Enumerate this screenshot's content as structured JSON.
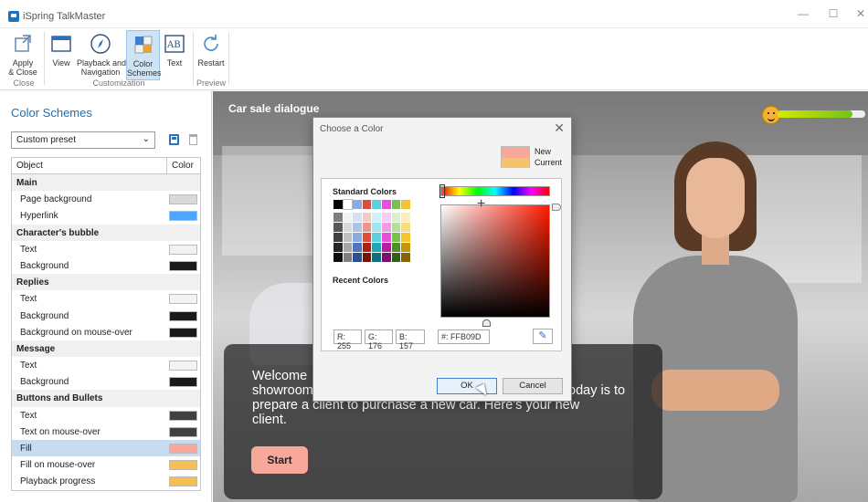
{
  "window": {
    "title": "iSpring TalkMaster",
    "minimize": "—",
    "maximize": "☐",
    "close": "✕"
  },
  "ribbon": {
    "buttons": [
      {
        "label": "Apply\n& Close",
        "icon": "apply-close-icon"
      },
      {
        "label": "View",
        "icon": "view-icon"
      },
      {
        "label": "Playback and\nNavigation",
        "icon": "compass-icon"
      },
      {
        "label": "Color\nSchemes",
        "icon": "color-schemes-icon"
      },
      {
        "label": "Text",
        "icon": "text-icon"
      },
      {
        "label": "Restart",
        "icon": "restart-icon"
      }
    ],
    "groups": [
      "Close",
      "Customization",
      "Preview"
    ]
  },
  "left_panel": {
    "title": "Color Schemes",
    "preset": "Custom preset",
    "table": {
      "col_object": "Object",
      "col_color": "Color",
      "rows": [
        {
          "type": "group",
          "label": "Main"
        },
        {
          "type": "item",
          "label": "Page background",
          "color": "#d9d9d9"
        },
        {
          "type": "item",
          "label": "Hyperlink",
          "color": "#4da6ff"
        },
        {
          "type": "group",
          "label": "Character's bubble"
        },
        {
          "type": "item",
          "label": "Text",
          "color": "#f2f2f2"
        },
        {
          "type": "item",
          "label": "Background",
          "color": "#1a1a1a"
        },
        {
          "type": "group",
          "label": "Replies"
        },
        {
          "type": "item",
          "label": "Text",
          "color": "#f2f2f2"
        },
        {
          "type": "item",
          "label": "Background",
          "color": "#1a1a1a"
        },
        {
          "type": "item",
          "label": "Background on mouse-over",
          "color": "#1a1a1a"
        },
        {
          "type": "group",
          "label": "Message"
        },
        {
          "type": "item",
          "label": "Text",
          "color": "#f2f2f2"
        },
        {
          "type": "item",
          "label": "Background",
          "color": "#1a1a1a"
        },
        {
          "type": "group",
          "label": "Buttons and Bullets"
        },
        {
          "type": "item",
          "label": "Text",
          "color": "#404040"
        },
        {
          "type": "item",
          "label": "Text on mouse-over",
          "color": "#404040"
        },
        {
          "type": "item",
          "label": "Fill",
          "color": "#f8a89b",
          "selected": true
        },
        {
          "type": "item",
          "label": "Fill on mouse-over",
          "color": "#f5bf54"
        },
        {
          "type": "item",
          "label": "Playback progress",
          "color": "#f5bf54"
        }
      ]
    }
  },
  "preview": {
    "title": "Car sale dialogue",
    "meter_level": 0.85,
    "message": "Welcome to the showroom! Your task today is to prepare a client to purchase a new car. Here's your new client.",
    "message_visible": {
      "line1": "Welcome",
      "line2a": "showroom",
      "line2b": "oday is to",
      "line3": "prepare a client to purchase a new car. Here's your new",
      "line4": "client."
    },
    "start_label": "Start"
  },
  "dialog": {
    "title": "Choose a Color",
    "new_label": "New",
    "current_label": "Current",
    "new_color": "#f8a89b",
    "current_color": "#f5c36a",
    "standard_colors_label": "Standard Colors",
    "recent_colors_label": "Recent Colors",
    "standard_top": [
      "#000000",
      "#ffffff",
      "#8ea9db",
      "#e04b3a",
      "#5fcfdc",
      "#e84fd6",
      "#77c247",
      "#f4c431"
    ],
    "standard_cols": [
      [
        "#7f7f7f",
        "#595959",
        "#404040",
        "#262626",
        "#0d0d0d"
      ],
      [
        "#f2f2f2",
        "#d9d9d9",
        "#bfbfbf",
        "#a6a6a6",
        "#808080"
      ],
      [
        "#d6e0f3",
        "#adc2e7",
        "#8ea9db",
        "#4f75bf",
        "#2e4f8f"
      ],
      [
        "#f7c9c3",
        "#ef9488",
        "#e04b3a",
        "#b02010",
        "#761408"
      ],
      [
        "#cff3f7",
        "#9fe7ef",
        "#5fcfdc",
        "#1ea9b8",
        "#11707b"
      ],
      [
        "#f8cdf3",
        "#f19be8",
        "#e84fd6",
        "#b51da4",
        "#78126d"
      ],
      [
        "#d9f0ca",
        "#b4e195",
        "#77c247",
        "#4f8f24",
        "#345f18"
      ],
      [
        "#fcedc0",
        "#f9db82",
        "#f4c431",
        "#c69609",
        "#846406"
      ]
    ],
    "r_label": "R: 255",
    "g_label": "G: 176",
    "b_label": "B: 157",
    "hex_label": "#: FFB09D",
    "ok_label": "OK",
    "cancel_label": "Cancel"
  }
}
